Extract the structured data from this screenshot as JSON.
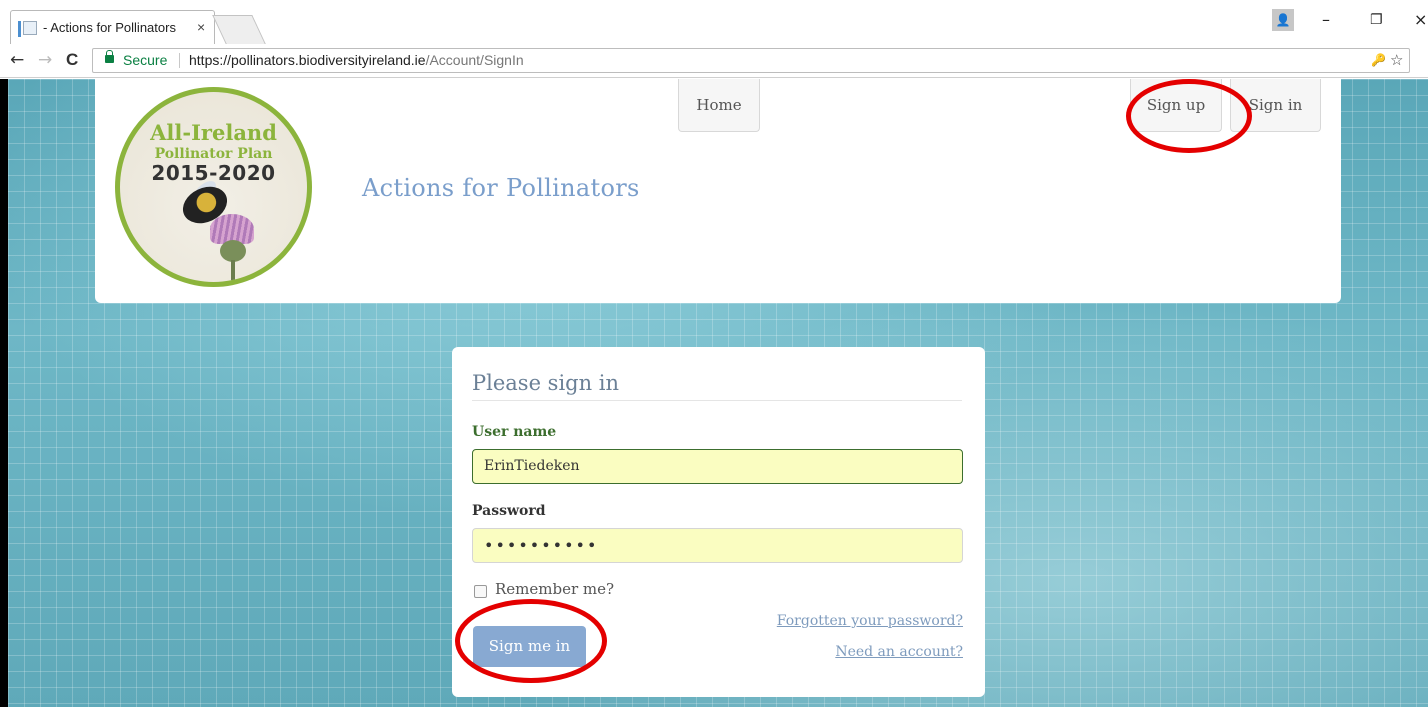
{
  "browser": {
    "tab_title": "- Actions for Pollinators",
    "tab_close": "×",
    "secure_label": "Secure",
    "url_host": "https://pollinators.biodiversityireland.ie",
    "url_path": "/Account/SignIn",
    "back_icon": "←",
    "forward_icon": "→",
    "reload_icon": "C",
    "minimize_icon": "–",
    "restore_icon": "❐",
    "close_icon": "×",
    "key_icon": "🔑",
    "star_icon": "☆"
  },
  "site": {
    "logo": {
      "line1": "All-Ireland",
      "line2": "Pollinator Plan",
      "line3": "2015-2020"
    },
    "title": "Actions for Pollinators",
    "nav": {
      "home": "Home",
      "signup": "Sign up",
      "signin": "Sign in"
    }
  },
  "signin_form": {
    "heading": "Please sign in",
    "username_label": "User name",
    "username_value": "ErinTiedeken",
    "password_label": "Password",
    "password_value": "••••••••••",
    "remember_label": "Remember me?",
    "remember_checked": false,
    "submit_label": "Sign me in",
    "forgot_link": "Forgotten your password?",
    "need_account_link": "Need an account?"
  },
  "annotations": {
    "highlight_color": "#e40000"
  }
}
